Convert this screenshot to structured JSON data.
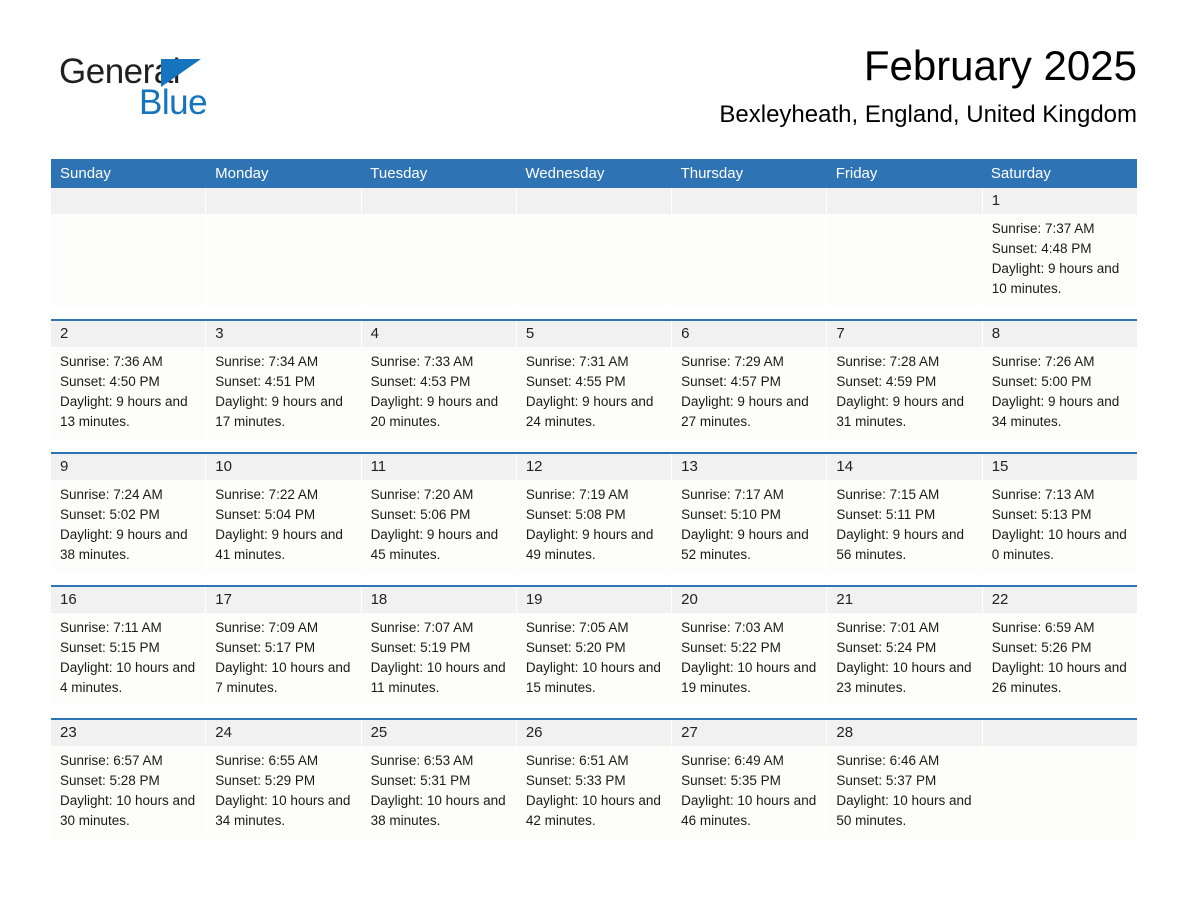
{
  "brand": {
    "name_part1": "General",
    "name_part2": "Blue",
    "triangle_color": "#1574bd"
  },
  "header": {
    "title": "February 2025",
    "subtitle": "Bexleyheath, England, United Kingdom"
  },
  "colors": {
    "header_blue": "#2e74b5",
    "row_divider_blue": "#2e74b5",
    "day_number_band": "#f1f1f1",
    "cell_background": "#fdfdfc"
  },
  "weekdays": [
    "Sunday",
    "Monday",
    "Tuesday",
    "Wednesday",
    "Thursday",
    "Friday",
    "Saturday"
  ],
  "weeks": [
    [
      {
        "day": "",
        "sunrise": "",
        "sunset": "",
        "daylight": "",
        "empty": true
      },
      {
        "day": "",
        "sunrise": "",
        "sunset": "",
        "daylight": "",
        "empty": true
      },
      {
        "day": "",
        "sunrise": "",
        "sunset": "",
        "daylight": "",
        "empty": true
      },
      {
        "day": "",
        "sunrise": "",
        "sunset": "",
        "daylight": "",
        "empty": true
      },
      {
        "day": "",
        "sunrise": "",
        "sunset": "",
        "daylight": "",
        "empty": true
      },
      {
        "day": "",
        "sunrise": "",
        "sunset": "",
        "daylight": "",
        "empty": true
      },
      {
        "day": "1",
        "sunrise": "Sunrise: 7:37 AM",
        "sunset": "Sunset: 4:48 PM",
        "daylight": "Daylight: 9 hours and 10 minutes.",
        "empty": false
      }
    ],
    [
      {
        "day": "2",
        "sunrise": "Sunrise: 7:36 AM",
        "sunset": "Sunset: 4:50 PM",
        "daylight": "Daylight: 9 hours and 13 minutes.",
        "empty": false
      },
      {
        "day": "3",
        "sunrise": "Sunrise: 7:34 AM",
        "sunset": "Sunset: 4:51 PM",
        "daylight": "Daylight: 9 hours and 17 minutes.",
        "empty": false
      },
      {
        "day": "4",
        "sunrise": "Sunrise: 7:33 AM",
        "sunset": "Sunset: 4:53 PM",
        "daylight": "Daylight: 9 hours and 20 minutes.",
        "empty": false
      },
      {
        "day": "5",
        "sunrise": "Sunrise: 7:31 AM",
        "sunset": "Sunset: 4:55 PM",
        "daylight": "Daylight: 9 hours and 24 minutes.",
        "empty": false
      },
      {
        "day": "6",
        "sunrise": "Sunrise: 7:29 AM",
        "sunset": "Sunset: 4:57 PM",
        "daylight": "Daylight: 9 hours and 27 minutes.",
        "empty": false
      },
      {
        "day": "7",
        "sunrise": "Sunrise: 7:28 AM",
        "sunset": "Sunset: 4:59 PM",
        "daylight": "Daylight: 9 hours and 31 minutes.",
        "empty": false
      },
      {
        "day": "8",
        "sunrise": "Sunrise: 7:26 AM",
        "sunset": "Sunset: 5:00 PM",
        "daylight": "Daylight: 9 hours and 34 minutes.",
        "empty": false
      }
    ],
    [
      {
        "day": "9",
        "sunrise": "Sunrise: 7:24 AM",
        "sunset": "Sunset: 5:02 PM",
        "daylight": "Daylight: 9 hours and 38 minutes.",
        "empty": false
      },
      {
        "day": "10",
        "sunrise": "Sunrise: 7:22 AM",
        "sunset": "Sunset: 5:04 PM",
        "daylight": "Daylight: 9 hours and 41 minutes.",
        "empty": false
      },
      {
        "day": "11",
        "sunrise": "Sunrise: 7:20 AM",
        "sunset": "Sunset: 5:06 PM",
        "daylight": "Daylight: 9 hours and 45 minutes.",
        "empty": false
      },
      {
        "day": "12",
        "sunrise": "Sunrise: 7:19 AM",
        "sunset": "Sunset: 5:08 PM",
        "daylight": "Daylight: 9 hours and 49 minutes.",
        "empty": false
      },
      {
        "day": "13",
        "sunrise": "Sunrise: 7:17 AM",
        "sunset": "Sunset: 5:10 PM",
        "daylight": "Daylight: 9 hours and 52 minutes.",
        "empty": false
      },
      {
        "day": "14",
        "sunrise": "Sunrise: 7:15 AM",
        "sunset": "Sunset: 5:11 PM",
        "daylight": "Daylight: 9 hours and 56 minutes.",
        "empty": false
      },
      {
        "day": "15",
        "sunrise": "Sunrise: 7:13 AM",
        "sunset": "Sunset: 5:13 PM",
        "daylight": "Daylight: 10 hours and 0 minutes.",
        "empty": false
      }
    ],
    [
      {
        "day": "16",
        "sunrise": "Sunrise: 7:11 AM",
        "sunset": "Sunset: 5:15 PM",
        "daylight": "Daylight: 10 hours and 4 minutes.",
        "empty": false
      },
      {
        "day": "17",
        "sunrise": "Sunrise: 7:09 AM",
        "sunset": "Sunset: 5:17 PM",
        "daylight": "Daylight: 10 hours and 7 minutes.",
        "empty": false
      },
      {
        "day": "18",
        "sunrise": "Sunrise: 7:07 AM",
        "sunset": "Sunset: 5:19 PM",
        "daylight": "Daylight: 10 hours and 11 minutes.",
        "empty": false
      },
      {
        "day": "19",
        "sunrise": "Sunrise: 7:05 AM",
        "sunset": "Sunset: 5:20 PM",
        "daylight": "Daylight: 10 hours and 15 minutes.",
        "empty": false
      },
      {
        "day": "20",
        "sunrise": "Sunrise: 7:03 AM",
        "sunset": "Sunset: 5:22 PM",
        "daylight": "Daylight: 10 hours and 19 minutes.",
        "empty": false
      },
      {
        "day": "21",
        "sunrise": "Sunrise: 7:01 AM",
        "sunset": "Sunset: 5:24 PM",
        "daylight": "Daylight: 10 hours and 23 minutes.",
        "empty": false
      },
      {
        "day": "22",
        "sunrise": "Sunrise: 6:59 AM",
        "sunset": "Sunset: 5:26 PM",
        "daylight": "Daylight: 10 hours and 26 minutes.",
        "empty": false
      }
    ],
    [
      {
        "day": "23",
        "sunrise": "Sunrise: 6:57 AM",
        "sunset": "Sunset: 5:28 PM",
        "daylight": "Daylight: 10 hours and 30 minutes.",
        "empty": false
      },
      {
        "day": "24",
        "sunrise": "Sunrise: 6:55 AM",
        "sunset": "Sunset: 5:29 PM",
        "daylight": "Daylight: 10 hours and 34 minutes.",
        "empty": false
      },
      {
        "day": "25",
        "sunrise": "Sunrise: 6:53 AM",
        "sunset": "Sunset: 5:31 PM",
        "daylight": "Daylight: 10 hours and 38 minutes.",
        "empty": false
      },
      {
        "day": "26",
        "sunrise": "Sunrise: 6:51 AM",
        "sunset": "Sunset: 5:33 PM",
        "daylight": "Daylight: 10 hours and 42 minutes.",
        "empty": false
      },
      {
        "day": "27",
        "sunrise": "Sunrise: 6:49 AM",
        "sunset": "Sunset: 5:35 PM",
        "daylight": "Daylight: 10 hours and 46 minutes.",
        "empty": false
      },
      {
        "day": "28",
        "sunrise": "Sunrise: 6:46 AM",
        "sunset": "Sunset: 5:37 PM",
        "daylight": "Daylight: 10 hours and 50 minutes.",
        "empty": false
      },
      {
        "day": "",
        "sunrise": "",
        "sunset": "",
        "daylight": "",
        "empty": true
      }
    ]
  ]
}
